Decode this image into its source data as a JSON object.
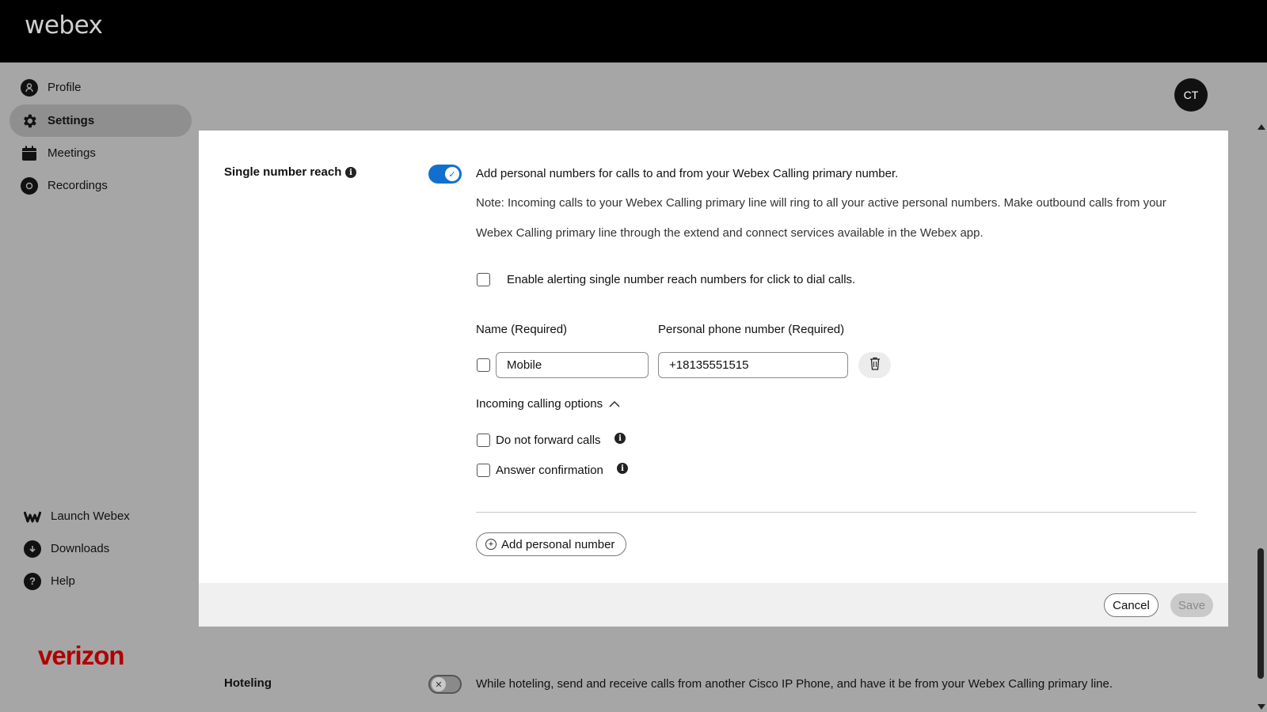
{
  "header": {
    "logo": "webex"
  },
  "sidebar": {
    "items": [
      {
        "label": "Profile",
        "icon": "profile-icon"
      },
      {
        "label": "Settings",
        "icon": "gear-icon",
        "active": true
      },
      {
        "label": "Meetings",
        "icon": "calendar-icon"
      },
      {
        "label": "Recordings",
        "icon": "record-icon"
      }
    ],
    "bottom_items": [
      {
        "label": "Launch Webex",
        "icon": "webex-icon"
      },
      {
        "label": "Downloads",
        "icon": "download-icon"
      },
      {
        "label": "Help",
        "icon": "help-icon"
      }
    ],
    "brand": "verizon"
  },
  "user": {
    "initials": "CT"
  },
  "snr": {
    "label": "Single number reach",
    "enabled": true,
    "description": "Add personal numbers for calls to and from your Webex Calling primary number.",
    "note_line1": "Note: Incoming calls to your Webex Calling primary line will ring to all your active personal numbers. Make outbound calls from your",
    "note_line2": "Webex Calling primary line through the extend and connect services available in the Webex app.",
    "alerting_label": "Enable alerting single number reach numbers for click to dial calls.",
    "name_header": "Name (Required)",
    "phone_header": "Personal phone number (Required)",
    "entry": {
      "name": "Mobile",
      "phone": "+18135551515"
    },
    "incoming_options_label": "Incoming calling options",
    "do_not_forward_label": "Do not forward calls",
    "answer_confirmation_label": "Answer confirmation",
    "add_label": "Add personal number",
    "cancel_label": "Cancel",
    "save_label": "Save"
  },
  "hoteling": {
    "label": "Hoteling",
    "enabled": false,
    "description": "While hoteling, send and receive calls from another Cisco IP Phone, and have it be from your Webex Calling primary line."
  },
  "colors": {
    "accent": "#1170cf",
    "brand": "#b00000"
  }
}
